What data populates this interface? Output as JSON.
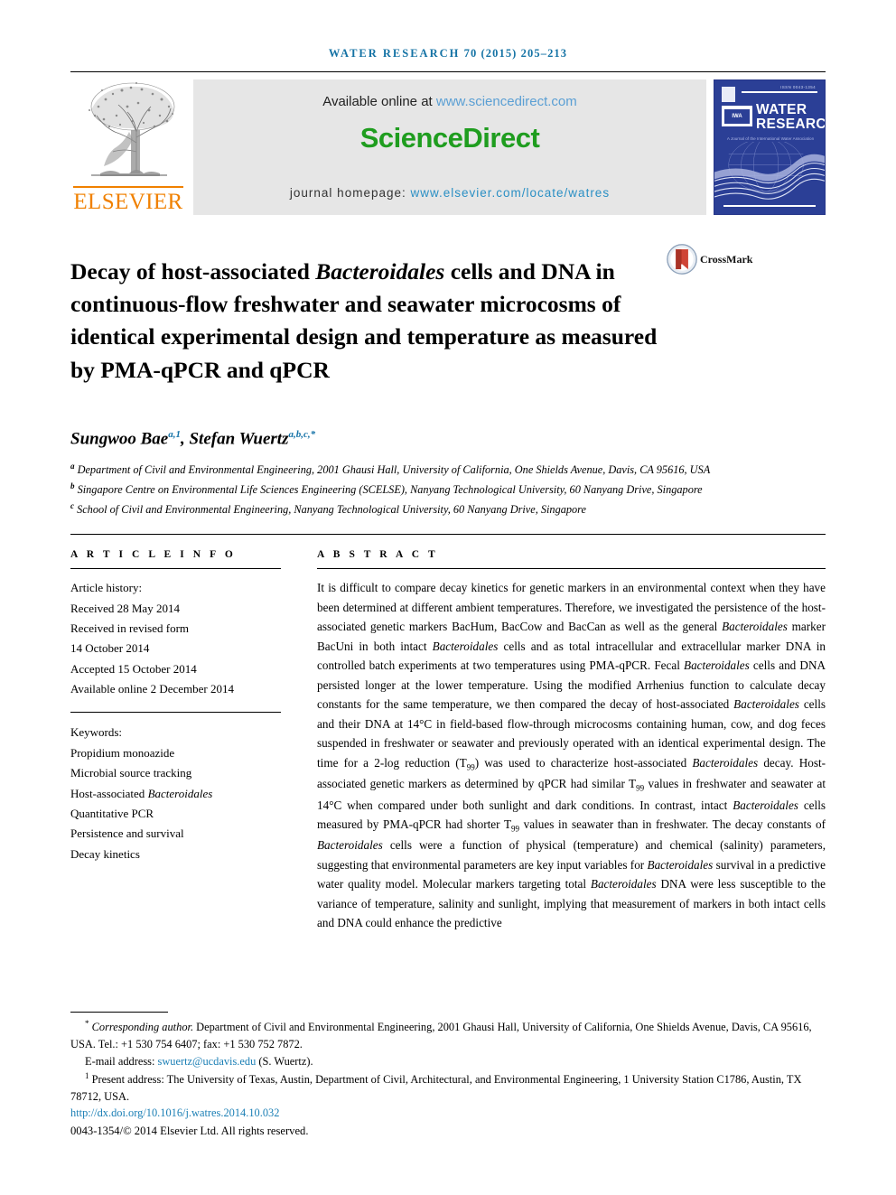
{
  "running_head": {
    "journal": "WATER RESEARCH",
    "citation": "70 (2015) 205–213"
  },
  "masthead": {
    "publisher_name": "ELSEVIER",
    "publisher_logo_alt": "tree-logo",
    "available_label": "Available online at ",
    "available_link": "www.sciencedirect.com",
    "sciencedirect_wordmark": "ScienceDirect",
    "homepage_label": "journal homepage: ",
    "homepage_link": "www.elsevier.com/locate/watres",
    "cover": {
      "issn": "ISSN 0043-1354",
      "iwa_label": "IWA",
      "title_line1": "WATER",
      "title_line2": "RESEARCH",
      "subtitle": "A Journal of the International Water Association"
    }
  },
  "article": {
    "title_part1": "Decay of host-associated ",
    "title_italic1": "Bacteroidales",
    "title_part2": " cells and DNA in continuous-flow freshwater and seawater microcosms of identical experimental design and temperature as measured by PMA-qPCR and qPCR",
    "crossmark_label": "CrossMark",
    "crossmark_icon": "crossmark-icon"
  },
  "authors": {
    "line": "Sungwoo Bae",
    "author1_name": "Sungwoo Bae",
    "author1_sup": "a,1",
    "separator": ", ",
    "author2_name": "Stefan Wuertz",
    "author2_sup": "a,b,c,*",
    "affiliations": [
      {
        "marker": "a",
        "text": "Department of Civil and Environmental Engineering, 2001 Ghausi Hall, University of California, One Shields Avenue, Davis, CA 95616, USA"
      },
      {
        "marker": "b",
        "text": "Singapore Centre on Environmental Life Sciences Engineering (SCELSE), Nanyang Technological University, 60 Nanyang Drive, Singapore"
      },
      {
        "marker": "c",
        "text": "School of Civil and Environmental Engineering, Nanyang Technological University, 60 Nanyang Drive, Singapore"
      }
    ]
  },
  "article_info": {
    "heading": "A R T I C L E   I N F O",
    "history_label": "Article history:",
    "history": [
      "Received 28 May 2014",
      "Received in revised form",
      "14 October 2014",
      "Accepted 15 October 2014",
      "Available online 2 December 2014"
    ],
    "keywords_label": "Keywords:",
    "keywords": [
      "Propidium monoazide",
      "Microbial source tracking",
      "Host-associated Bacteroidales",
      "Quantitative PCR",
      "Persistence and survival",
      "Decay kinetics"
    ]
  },
  "abstract": {
    "heading": "A B S T R A C T",
    "paragraph": "It is difficult to compare decay kinetics for genetic markers in an environmental context when they have been determined at different ambient temperatures. Therefore, we investigated the persistence of the host-associated genetic markers BacHum, BacCow and BacCan as well as the general Bacteroidales marker BacUni in both intact Bacteroidales cells and as total intracellular and extracellular marker DNA in controlled batch experiments at two temperatures using PMA-qPCR. Fecal Bacteroidales cells and DNA persisted longer at the lower temperature. Using the modified Arrhenius function to calculate decay constants for the same temperature, we then compared the decay of host-associated Bacteroidales cells and their DNA at 14°C in field-based flow-through microcosms containing human, cow, and dog feces suspended in freshwater or seawater and previously operated with an identical experimental design. The time for a 2-log reduction (T99) was used to characterize host-associated Bacteroidales decay. Host-associated genetic markers as determined by qPCR had similar T99 values in freshwater and seawater at 14°C when compared under both sunlight and dark conditions. In contrast, intact Bacteroidales cells measured by PMA-qPCR had shorter T99 values in seawater than in freshwater. The decay constants of Bacteroidales cells were a function of physical (temperature) and chemical (salinity) parameters, suggesting that environmental parameters are key input variables for Bacteroidales survival in a predictive water quality model. Molecular markers targeting total Bacteroidales DNA were less susceptible to the variance of temperature, salinity and sunlight, implying that measurement of markers in both intact cells and DNA could enhance the predictive"
  },
  "footnotes": {
    "corresponding_marker": "*",
    "corresponding_italic": "Corresponding author.",
    "corresponding_text": " Department of Civil and Environmental Engineering, 2001 Ghausi Hall, University of California, One Shields Avenue, Davis, CA 95616, USA. Tel.: +1 530 754 6407; fax: +1 530 752 7872.",
    "email_label": "E-mail address: ",
    "email_address": "swuertz@ucdavis.edu",
    "email_suffix": " (S. Wuertz).",
    "present_marker": "1",
    "present_text": " Present address: The University of Texas, Austin, Department of Civil, Architectural, and Environmental Engineering, 1 University Station C1786, Austin, TX 78712, USA.",
    "doi": "http://dx.doi.org/10.1016/j.watres.2014.10.032",
    "copyright": "0043-1354/© 2014 Elsevier Ltd. All rights reserved."
  },
  "colors": {
    "running_head": "#1573a5",
    "elsevier_orange": "#f08000",
    "sciencedirect_green": "#1f9d1f",
    "link_blue": "#2a8fc4",
    "cover_blue": "#2b3f96",
    "affil_sup_blue": "#1673a8"
  }
}
